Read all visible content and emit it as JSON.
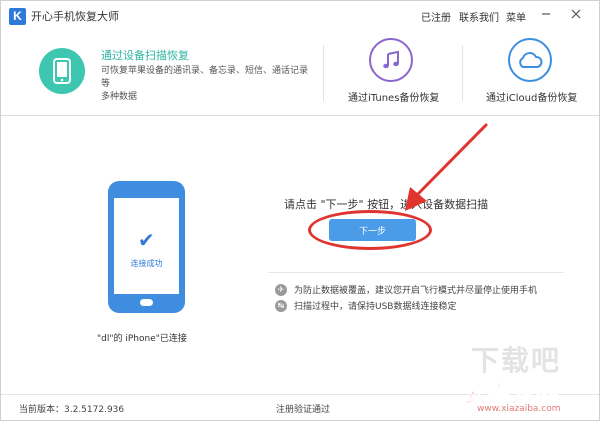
{
  "window": {
    "logo_letter": "K",
    "title": "开心手机恢复大师",
    "menu": [
      "已注册",
      "联系我们",
      "菜单"
    ]
  },
  "modes": {
    "device_scan": {
      "title": "通过设备扫描恢复",
      "desc_line1": "可恢复苹果设备的通讯录、备忘录、短信、通话记录等",
      "desc_line2": "多种数据"
    },
    "itunes": {
      "label": "通过iTunes备份恢复"
    },
    "icloud": {
      "label": "通过iCloud备份恢复"
    }
  },
  "device": {
    "status": "连接成功",
    "connected_text": "\"dl\"的 iPhone\"已连接"
  },
  "main": {
    "instruction": "请点击 \"下一步\" 按钮，进入设备数据扫描",
    "next_button": "下一步",
    "tips": [
      "为防止数据被覆盖，建议您开启飞行模式并尽量停止使用手机",
      "扫描过程中，请保持USB数据线连接稳定"
    ]
  },
  "footer": {
    "version": "当前版本：3.2.5172.936",
    "registration": "注册验证通过"
  },
  "watermark": {
    "line1": "下载吧",
    "line2": "云南龙网",
    "line3": "www.xiazaiba.com"
  },
  "colors": {
    "accent": "#4a9be8",
    "active_mode_text": "#2bb5a0",
    "annotation_red": "#e0342f",
    "mode_icon_purple": "#8a66cc",
    "mode_icon_blue": "#3a8fe0"
  }
}
